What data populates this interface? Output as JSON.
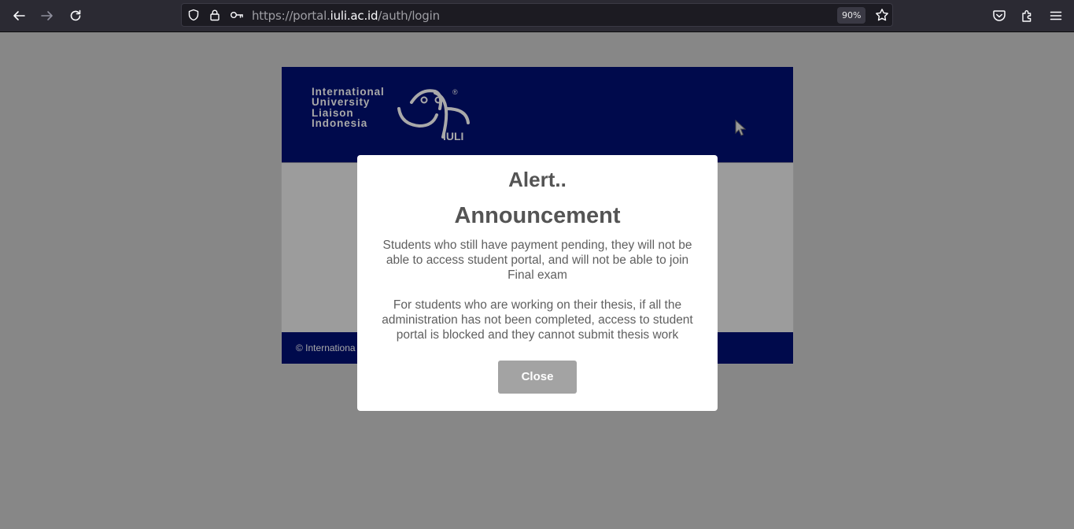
{
  "browser": {
    "url_prefix": "https://portal.",
    "url_host": "iuli.ac.id",
    "url_path": "/auth/login",
    "zoom": "90%",
    "toolbar_color": "#2b2a33"
  },
  "page": {
    "logo": {
      "lines": [
        "International",
        "University",
        "Liaison",
        "Indonesia"
      ],
      "mark_text": "IULI",
      "registered": "®"
    },
    "footer_text": "© Internationa",
    "header_color": "#000a4c"
  },
  "modal": {
    "title": "Alert..",
    "subtitle": "Announcement",
    "paragraphs": [
      "Students who still have payment pending, they will not be able to access student portal, and will not be able to join Final exam",
      "For students who are working on their thesis, if all the administration has not been completed, access to student portal is blocked and they cannot submit thesis work"
    ],
    "close_label": "Close"
  },
  "icons": [
    "back-icon",
    "forward-icon",
    "reload-icon",
    "shield-icon",
    "lock-icon",
    "key-icon",
    "star-icon",
    "pocket-icon",
    "extensions-icon",
    "menu-icon",
    "cursor-icon"
  ]
}
